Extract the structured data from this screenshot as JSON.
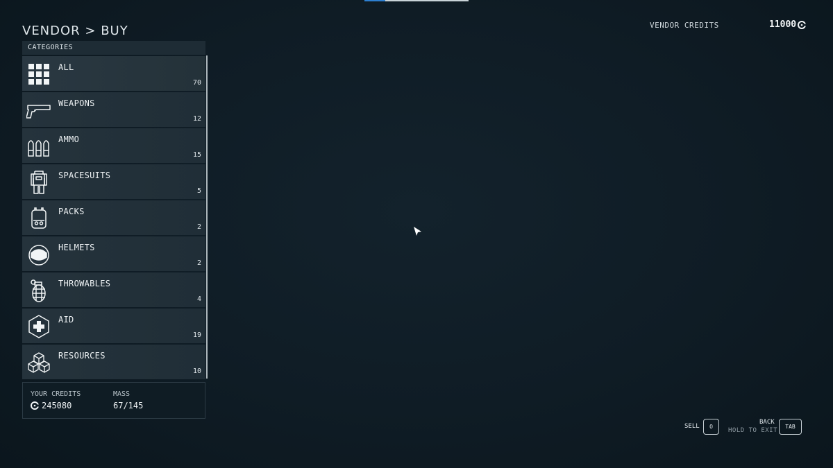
{
  "header": {
    "breadcrumb": "VENDOR > BUY",
    "vendor_credits_label": "VENDOR CREDITS",
    "vendor_credits_value": "11000"
  },
  "categories": {
    "header": "CATEGORIES",
    "items": [
      {
        "label": "ALL",
        "count": "70",
        "icon": "grid-icon"
      },
      {
        "label": "WEAPONS",
        "count": "12",
        "icon": "pistol-icon"
      },
      {
        "label": "AMMO",
        "count": "15",
        "icon": "bullets-icon"
      },
      {
        "label": "SPACESUITS",
        "count": "5",
        "icon": "spacesuit-icon"
      },
      {
        "label": "PACKS",
        "count": "2",
        "icon": "backpack-icon"
      },
      {
        "label": "HELMETS",
        "count": "2",
        "icon": "helmet-icon"
      },
      {
        "label": "THROWABLES",
        "count": "4",
        "icon": "grenade-icon"
      },
      {
        "label": "AID",
        "count": "19",
        "icon": "medkit-icon"
      },
      {
        "label": "RESOURCES",
        "count": "10",
        "icon": "cubes-icon"
      }
    ]
  },
  "footer": {
    "your_credits_label": "YOUR CREDITS",
    "your_credits_value": "245080",
    "mass_label": "MASS",
    "mass_value": "67/145"
  },
  "controls": {
    "sell_label": "SELL",
    "sell_key": "O",
    "back_label": "BACK",
    "back_sub": "HOLD TO EXIT",
    "back_key": "TAB"
  },
  "colors": {
    "background": "#0f1c25",
    "panel": "#25333c",
    "accent_blue": "#2d7fd0"
  }
}
